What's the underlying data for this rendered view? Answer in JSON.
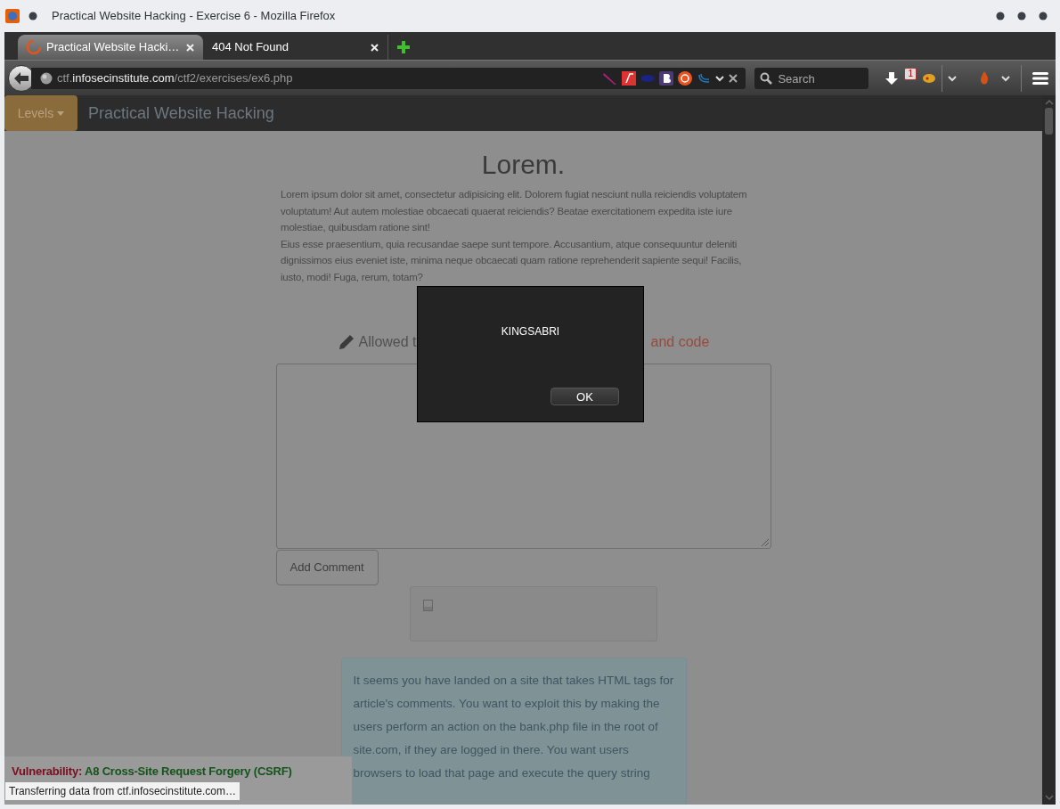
{
  "window": {
    "title": "Practical Website Hacking - Exercise 6 - Mozilla Firefox"
  },
  "tabs": [
    {
      "label": "Practical Website Hacki…",
      "selected": true
    },
    {
      "label": "404 Not Found",
      "selected": false
    }
  ],
  "address_bar": {
    "subdomain": "ctf.",
    "domain": "infosecinstitute.com",
    "path": "/ctf2/exercises/ex6.php"
  },
  "search": {
    "placeholder": "Search"
  },
  "toolbar_badge": "1",
  "site_nav": {
    "menu": "Levels",
    "brand": "Practical Website Hacking"
  },
  "article": {
    "title": "Lorem.",
    "paragraphs": [
      "Lorem ipsum dolor sit amet, consectetur adipisicing elit. Dolorem fugiat nesciunt nulla reiciendis voluptatem voluptatum! Aut autem molestiae obcaecati quaerat reiciendis? Beatae exercitationem expedita iste iure molestiae, quibusdam ratione sint!",
      "Eius esse praesentium, quia recusandae saepe sunt tempore. Accusantium, atque consequuntur deleniti dignissimos eius eveniet iste, minima neque obcaecati quam ratione reprehenderit sapiente sequi! Facilis, iusto, modi! Fuga, rerum, totam?"
    ]
  },
  "comment_heading": {
    "start": "Allowed t",
    "end": "and code"
  },
  "comment_button": "Add Comment",
  "info_text": "It seems you have landed on a site that takes HTML tags for article's comments. You want to exploit this by making the users perform an action on the bank.php file in the root of site.com, if they are logged in there. You want users browsers to load that page and execute the query string",
  "vulnerability": {
    "label": "Vulnerability:",
    "name": "A8 Cross-Site Request Forgery (CSRF)"
  },
  "status": "Transferring data from ctf.infosecinstitute.com…",
  "dialog": {
    "message": "KINGSABRI",
    "button": "OK"
  }
}
